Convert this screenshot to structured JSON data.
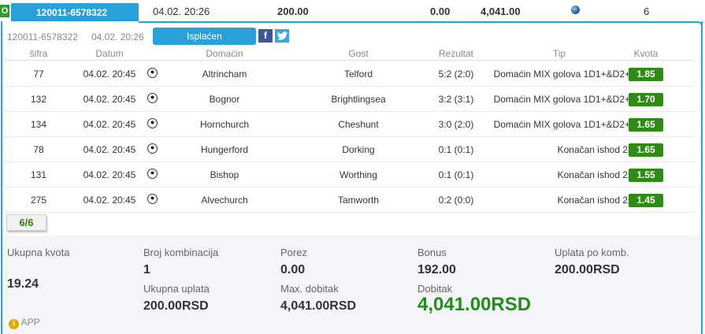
{
  "ticket": {
    "status": "O",
    "id": "120011-6578322",
    "datetime": "04.02. 20:26",
    "stake": "200.00",
    "zero": "0.00",
    "win": "4,041.00",
    "count": "6",
    "status_dot_color": "#2b6aa8"
  },
  "detail": {
    "id": "120011-6578322",
    "datetime": "04.02. 20:26",
    "paid_label": "Isplaćen",
    "facebook_icon": "facebook-icon",
    "twitter_icon": "twitter-icon"
  },
  "table": {
    "headers": {
      "code": "šifra",
      "date": "Datum",
      "home": "Domaćin",
      "guest": "Gost",
      "result": "Rezultat",
      "tip": "Tip",
      "odd": "Kvota"
    },
    "rows": [
      {
        "code": "77",
        "date": "04.02. 20:45",
        "sport_icon": "football-icon",
        "home": "Altrincham",
        "guest": "Telford",
        "result": "5:2 (2:0)",
        "tip": "Domaćin MIX golova 1D1+&D2+",
        "odd": "1.85"
      },
      {
        "code": "132",
        "date": "04.02. 20:45",
        "sport_icon": "football-icon",
        "home": "Bognor",
        "guest": "Brightlingsea",
        "result": "3:2 (3:1)",
        "tip": "Domaćin MIX golova 1D1+&D2+",
        "odd": "1.70"
      },
      {
        "code": "134",
        "date": "04.02. 20:45",
        "sport_icon": "football-icon",
        "home": "Hornchurch",
        "guest": "Cheshunt",
        "result": "3:0 (2:0)",
        "tip": "Domaćin MIX golova 1D1+&D2+",
        "odd": "1.65"
      },
      {
        "code": "78",
        "date": "04.02. 20:45",
        "sport_icon": "football-icon",
        "home": "Hungerford",
        "guest": "Dorking",
        "result": "0:1 (0:1)",
        "tip": "Konačan ishod 2",
        "odd": "1.65"
      },
      {
        "code": "131",
        "date": "04.02. 20:45",
        "sport_icon": "football-icon",
        "home": "Bishop",
        "guest": "Worthing",
        "result": "0:1 (0:1)",
        "tip": "Konačan ishod 2",
        "odd": "1.55"
      },
      {
        "code": "275",
        "date": "04.02. 20:45",
        "sport_icon": "football-icon",
        "home": "Alvechurch",
        "guest": "Tamworth",
        "result": "0:2 (0:0)",
        "tip": "Konačan ishod 2",
        "odd": "1.45"
      }
    ],
    "hits": "6/6"
  },
  "summary": {
    "total_odd_label": "Ukupna kvota",
    "total_odd": "19.24",
    "combinations_label": "Broj kombinacija",
    "combinations": "1",
    "total_payment_label": "Ukupna uplata",
    "total_payment": "200.00RSD",
    "tax_label": "Porez",
    "tax": "0.00",
    "max_win_label": "Max. dobitak",
    "max_win": "4,041.00RSD",
    "bonus_label": "Bonus",
    "bonus": "192.00",
    "win_label": "Dobitak",
    "win": "4,041.00RSD",
    "per_comb_label": "Uplata po komb.",
    "per_comb": "200.00RSD",
    "app_label": "APP",
    "app_icon": "info-icon",
    "win_color": "#1f8f14"
  },
  "colors": {
    "accent": "#2aa1d6",
    "odd_badge": "#2e8b13",
    "status": "#2c9b2c"
  }
}
